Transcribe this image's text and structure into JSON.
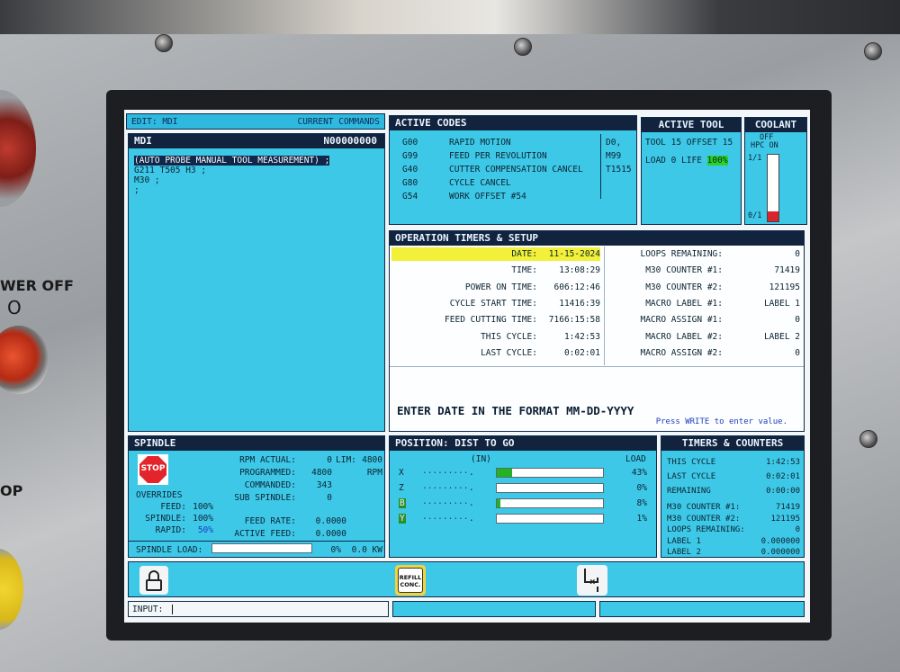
{
  "side": {
    "power_off_label": "WER OFF",
    "power_off_symbol": "O",
    "stop_label": "OP"
  },
  "edit_bar": {
    "mode": "EDIT: MDI",
    "title": "CURRENT COMMANDS"
  },
  "mdi": {
    "title": "MDI",
    "program": "N00000000",
    "lines": [
      "(AUTO PROBE MANUAL TOOL MEASUREMENT) ;",
      "G211 T505 H3 ;",
      "M30 ;",
      ";"
    ]
  },
  "active_codes": {
    "title": "ACTIVE CODES",
    "rows": [
      {
        "code": "G00",
        "desc": "RAPID MOTION",
        "extra": "D0,"
      },
      {
        "code": "G99",
        "desc": "FEED PER REVOLUTION",
        "extra": "M99"
      },
      {
        "code": "G40",
        "desc": "CUTTER COMPENSATION CANCEL",
        "extra": "T1515"
      },
      {
        "code": "G80",
        "desc": "CYCLE CANCEL",
        "extra": ""
      },
      {
        "code": "G54",
        "desc": "WORK OFFSET  #54",
        "extra": ""
      }
    ]
  },
  "active_tool": {
    "title": "ACTIVE TOOL",
    "tool_line": "TOOL 15 OFFSET 15",
    "load_line": "LOAD 0   LIFE",
    "life": "100%"
  },
  "coolant": {
    "title": "COOLANT",
    "status": "OFF",
    "hpc": "HPC ON",
    "top_level": "1/1",
    "bottom_level": "0/1",
    "level_fraction": 0.15
  },
  "timers": {
    "title": "OPERATION TIMERS & SETUP",
    "left": [
      {
        "label": "DATE:",
        "value": "11-15-2024"
      },
      {
        "label": "TIME:",
        "value": "13:08:29"
      },
      {
        "label": "POWER ON TIME:",
        "value": "606:12:46"
      },
      {
        "label": "CYCLE START TIME:",
        "value": "11416:39"
      },
      {
        "label": "FEED CUTTING TIME:",
        "value": "7166:15:58"
      },
      {
        "label": "THIS CYCLE:",
        "value": "1:42:53"
      },
      {
        "label": "LAST CYCLE:",
        "value": "0:02:01"
      }
    ],
    "right": [
      {
        "label": "LOOPS REMAINING:",
        "value": "0"
      },
      {
        "label": "M30 COUNTER #1:",
        "value": "71419"
      },
      {
        "label": "M30 COUNTER #2:",
        "value": "121195"
      },
      {
        "label": "MACRO LABEL #1:",
        "value": "LABEL 1"
      },
      {
        "label": "MACRO ASSIGN #1:",
        "value": "0"
      },
      {
        "label": "MACRO LABEL #2:",
        "value": "LABEL 2"
      },
      {
        "label": "MACRO ASSIGN #2:",
        "value": "0"
      }
    ],
    "prompt": "ENTER DATE IN THE FORMAT MM-DD-YYYY",
    "hint": "Press WRITE to enter value."
  },
  "spindle": {
    "title": "SPINDLE",
    "stop_label": "STOP",
    "overrides_label": "OVERRIDES",
    "feed_label": "FEED:",
    "feed_value": "100%",
    "spindle_label": "SPINDLE:",
    "spindle_value": "100%",
    "rapid_label": "RAPID:",
    "rapid_value": "50%",
    "rpm_actual_label": "RPM ACTUAL:",
    "rpm_actual_value": "0",
    "lim_label": "LIM:",
    "lim_value": "4800",
    "programmed_label": "PROGRAMMED:",
    "programmed_value": "4800",
    "rpm_unit": "RPM",
    "commanded_label": "COMMANDED:",
    "commanded_value": "343",
    "sub_spindle_label": "SUB SPINDLE:",
    "sub_spindle_value": "0",
    "feed_rate_label": "FEED RATE:",
    "feed_rate_value": "0.0000",
    "active_feed_label": "ACTIVE FEED:",
    "active_feed_value": "0.0000",
    "load_label": "SPINDLE LOAD:",
    "load_value": "0%",
    "kw_value": "0.0 KW"
  },
  "position": {
    "title": "POSITION:  DIST TO GO",
    "unit": "(IN)",
    "load_header": "LOAD",
    "axes": [
      {
        "axis": "X",
        "value": ".",
        "load": "43%",
        "fraction": 0.14
      },
      {
        "axis": "Z",
        "value": ".",
        "load": "0%",
        "fraction": 0.0
      },
      {
        "axis": "B",
        "value": ".",
        "load": "8%",
        "fraction": 0.03
      },
      {
        "axis": "Y",
        "value": ".",
        "load": "1%",
        "fraction": 0.0
      }
    ]
  },
  "timers_counters": {
    "title": "TIMERS & COUNTERS",
    "rows": [
      {
        "label": "THIS CYCLE",
        "value": "1:42:53"
      },
      {
        "label": "LAST CYCLE",
        "value": "0:02:01"
      },
      {
        "label": "REMAINING",
        "value": "0:00:00"
      },
      {
        "label": "M30 COUNTER #1:",
        "value": "71419"
      },
      {
        "label": "M30 COUNTER #2:",
        "value": "121195"
      },
      {
        "label": "LOOPS REMAINING:",
        "value": "0"
      },
      {
        "label": "LABEL 1",
        "value": "0.000000"
      },
      {
        "label": "LABEL 2",
        "value": "0.000000"
      }
    ]
  },
  "softkeys": {
    "refill_line1": "REFILL",
    "refill_line2": "CONC."
  },
  "input": {
    "label": "INPUT:",
    "value": ""
  }
}
